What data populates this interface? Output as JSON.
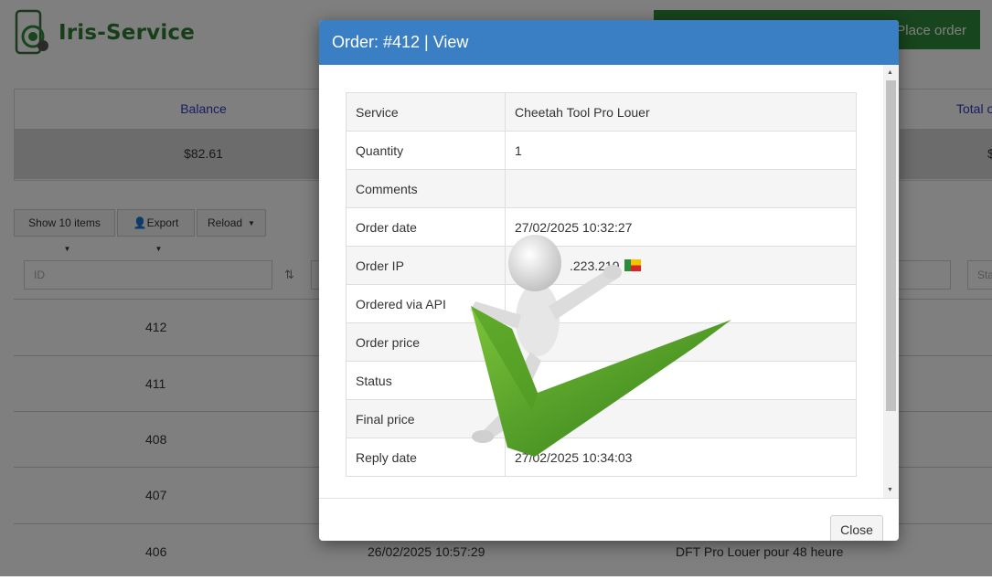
{
  "app": {
    "brand": "Iris-Service",
    "place_order_label": "Place order"
  },
  "stats": [
    {
      "label": "Balance",
      "value": "$82.61"
    },
    {
      "label": "Total o",
      "value": "$"
    }
  ],
  "toolbar": {
    "show_items_label": "Show 10 items",
    "export_label": "Export",
    "reload_label": "Reload"
  },
  "filters": {
    "id_placeholder": "ID",
    "status_placeholder": "Sta"
  },
  "orders_table": {
    "rows": [
      {
        "id": "412",
        "date": "",
        "service": ""
      },
      {
        "id": "411",
        "date": "",
        "service": ""
      },
      {
        "id": "408",
        "date": "",
        "service": ""
      },
      {
        "id": "407",
        "date": "",
        "service": ""
      },
      {
        "id": "406",
        "date": "26/02/2025 10:57:29",
        "service": "DFT Pro Louer pour 48 heure"
      }
    ]
  },
  "modal": {
    "title": "Order: #412 | View",
    "close_label": "Close",
    "details": [
      {
        "label": "Service",
        "value": "Cheetah Tool Pro Louer"
      },
      {
        "label": "Quantity",
        "value": "1"
      },
      {
        "label": "Comments",
        "value": ""
      },
      {
        "label": "Order date",
        "value": "27/02/2025 10:32:27"
      },
      {
        "label": "Order IP",
        "value": ".223.219"
      },
      {
        "label": "Ordered via API",
        "value": ""
      },
      {
        "label": "Order price",
        "value": ""
      },
      {
        "label": "Status",
        "value": ""
      },
      {
        "label": "Final price",
        "value": ""
      },
      {
        "label": "Reply date",
        "value": "27/02/2025 10:34:03"
      }
    ]
  },
  "colors": {
    "modal_header": "#3a7fc4",
    "brand_green": "#2e7d32",
    "place_order_bg": "#2e8b3a",
    "stat_label": "#2f3bbf"
  },
  "icons": {
    "export": "user-icon",
    "sort": "sort-icon",
    "flag": "flag-icon",
    "mascot": "checkmark-figure"
  }
}
